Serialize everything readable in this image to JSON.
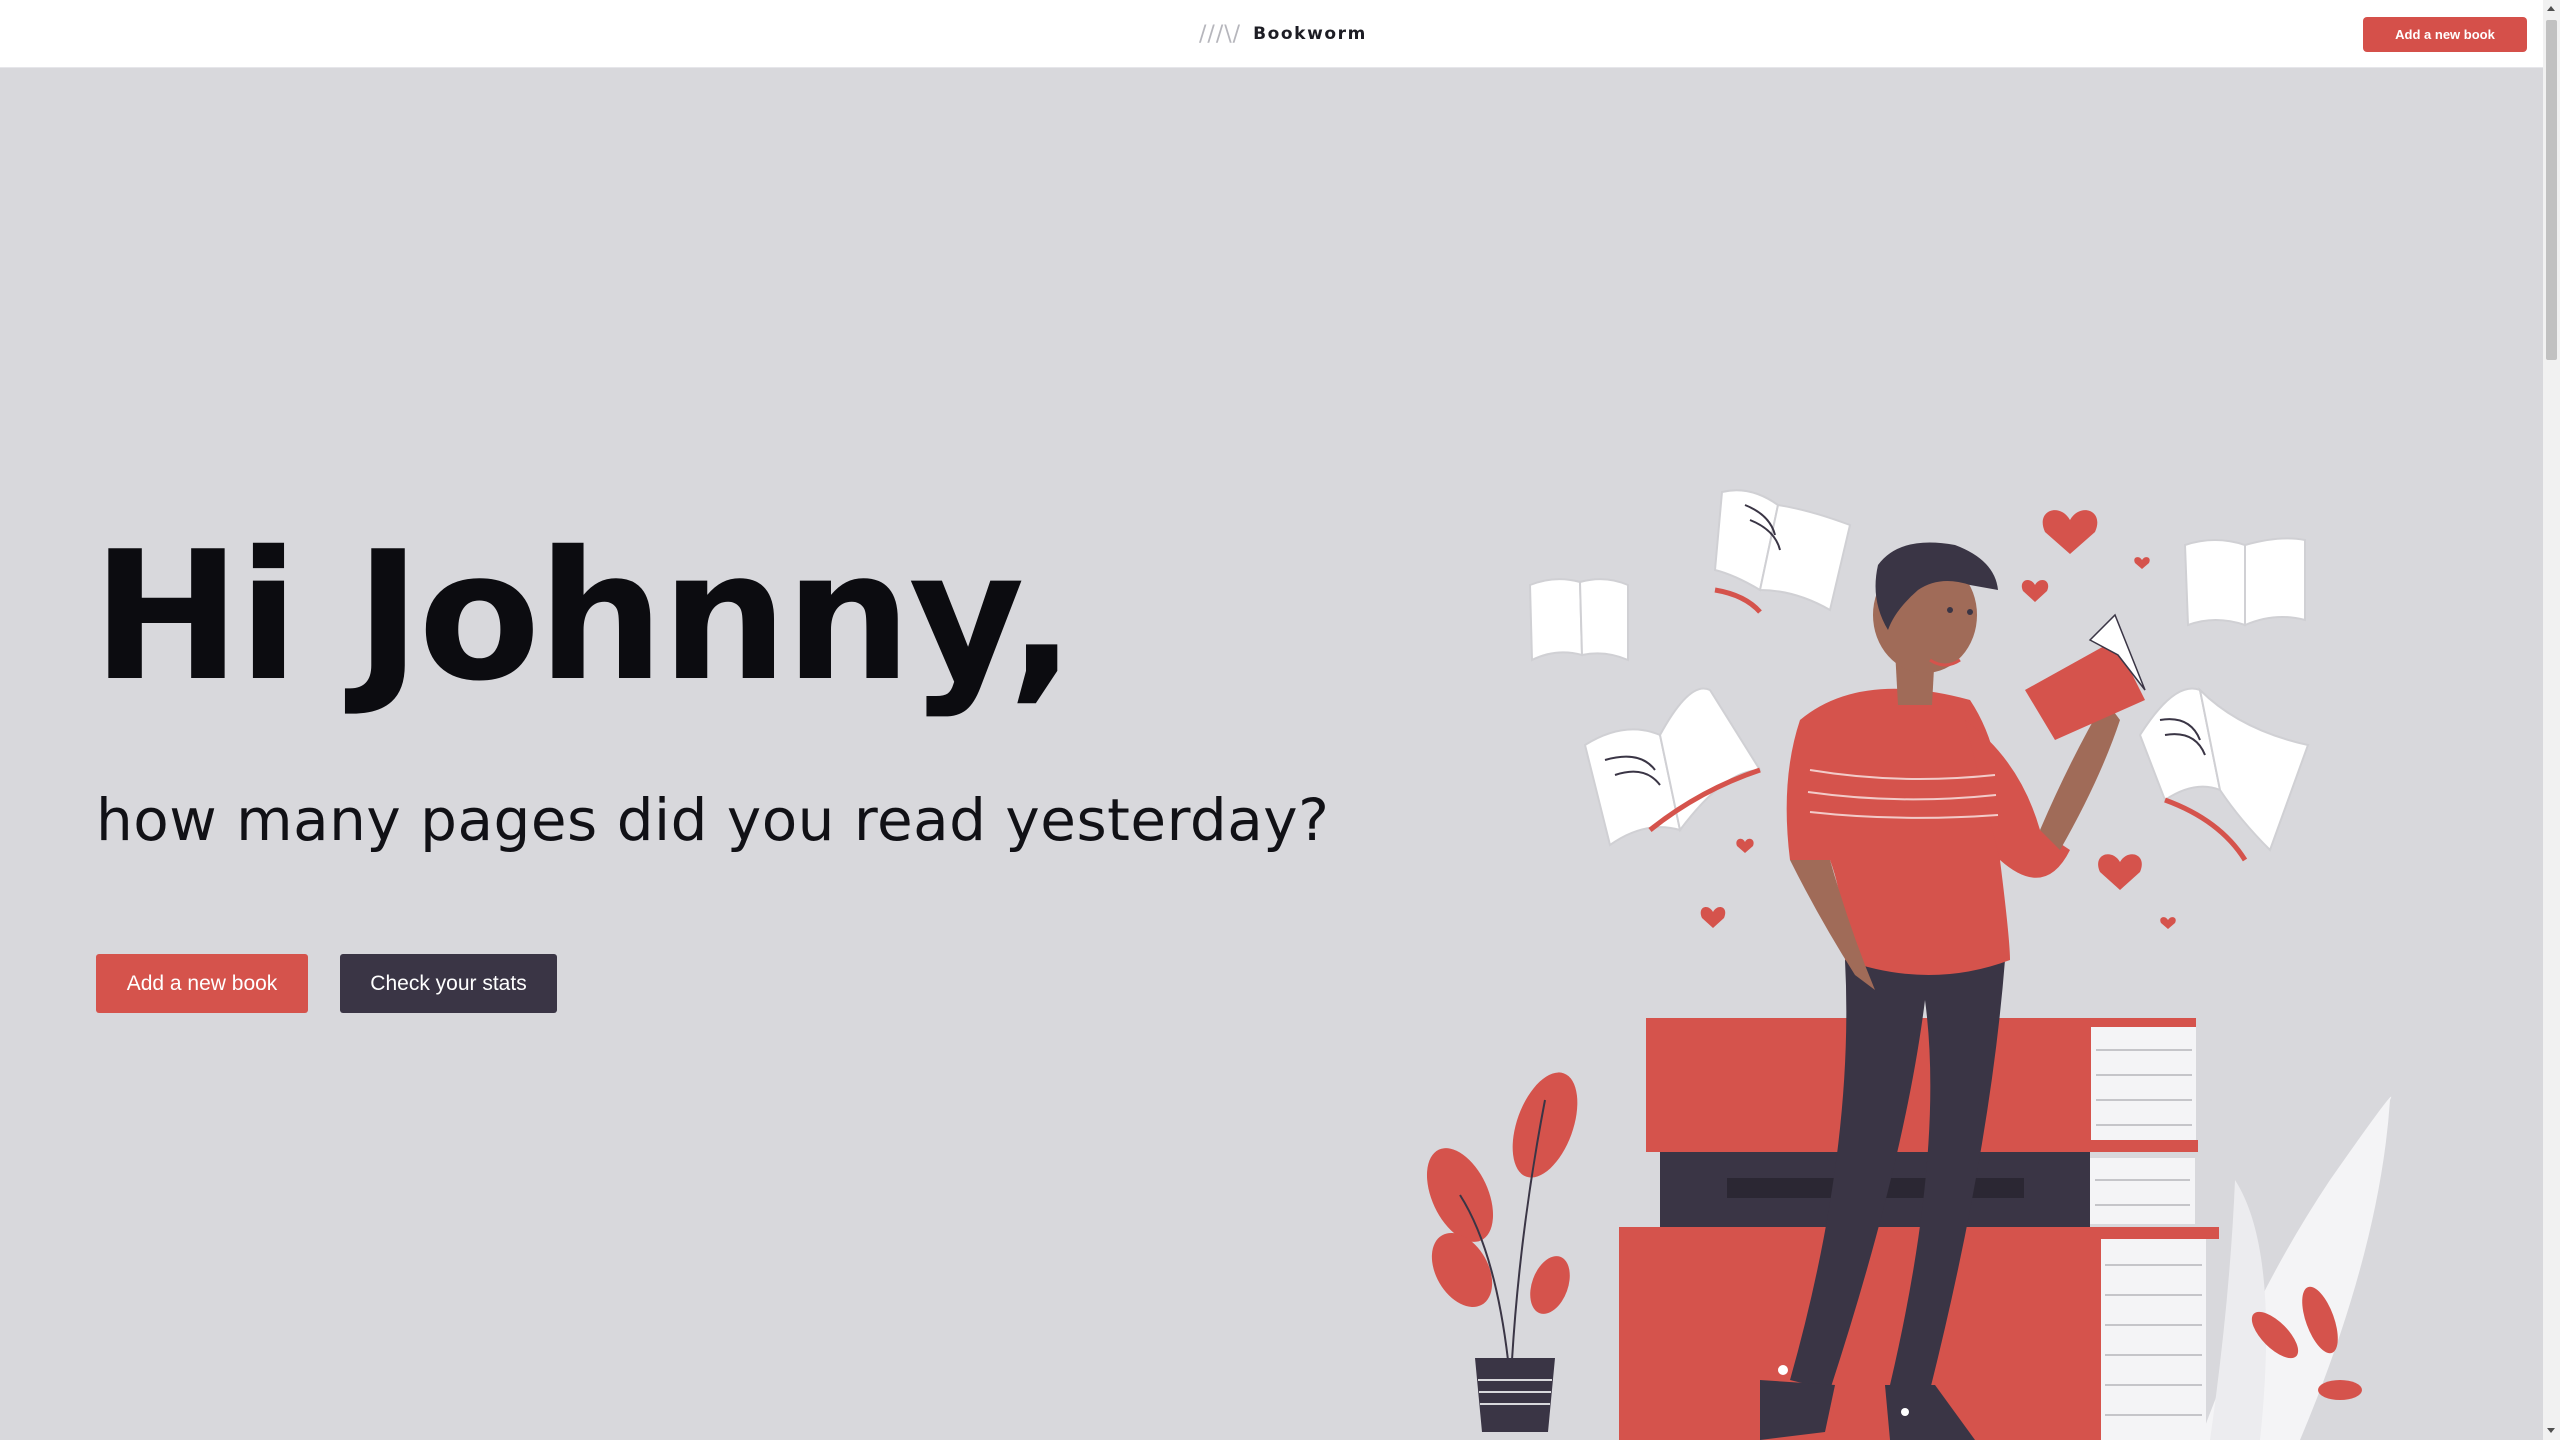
{
  "header": {
    "logo_mark": "///\\/",
    "brand_name": "Bookworm",
    "cta_label": "Add a new book"
  },
  "hero": {
    "greeting": "Hi Johnny,",
    "question": "how many pages did you read yesterday?",
    "primary_button": "Add a new book",
    "secondary_button": "Check your stats"
  },
  "colors": {
    "accent": "#d5534c",
    "dark": "#3a3545",
    "background": "#d8d8dc"
  },
  "illustration": {
    "icon": "person-reading-on-books-illustration"
  }
}
